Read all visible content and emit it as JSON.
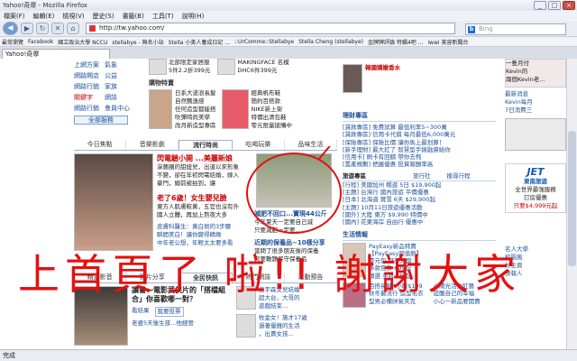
{
  "window": {
    "title": "Yahoo!奇摩 - Mozilla Firefox",
    "controls": [
      "_",
      "□",
      "×"
    ]
  },
  "menu": [
    "檔案(F)",
    "編輯(E)",
    "檢視(V)",
    "歷史(S)",
    "書籤(B)",
    "工具(T)",
    "說明(H)"
  ],
  "nav": {
    "url": "http://tw.yahoo.com/",
    "search_placeholder": "Bing",
    "search_engine_icon": "b"
  },
  "bookmarks": [
    "最常瀏覽",
    "Facebook",
    "國立政治大學 NCCU",
    "stellabye - 無名小站",
    "Stella 小美人養成日記 ...",
    "::UrComme::Stellabye",
    "Stella Cheng (stellabye)",
    "金牌牌評論 特輯4吧 ...",
    "iwwi 美容新聞台"
  ],
  "tab": {
    "label": "Yahoo!奇摩"
  },
  "page": {
    "left_services": {
      "rows": [
        [
          "上網方案",
          "氣象"
        ],
        [
          "網路開店",
          "公益"
        ],
        [
          "網路行銷",
          "家族"
        ],
        [
          "關鍵字",
          "網誌"
        ],
        [
          "網路行銷",
          "會員中心"
        ]
      ],
      "all_services": "全部服務"
    },
    "shopping": {
      "items": [
        "北部限定家居服",
        "5件2.2折399元"
      ],
      "items2": [
        "MAKINGFACE 名模",
        "DHC6件399元"
      ],
      "section_title": "購物特賣",
      "promo1": [
        "日系大波浪長髮",
        "自然飄逸感",
        "任何造型都能搭",
        "吹彈時尚美學",
        "改月新造型專區"
      ],
      "promo2": [
        "經典帆布鞋",
        "簡約百搭款",
        "NIKE新上架",
        "特價出清包鞋",
        "零元限量搶購中"
      ]
    },
    "tabs": [
      "今日焦點",
      "音樂影劇",
      "流行時尚",
      "吃喝玩樂",
      "品味生活"
    ],
    "active_tab_index": 2,
    "feature": {
      "headline": "閃電驗小開 ...美麗新娘",
      "body": [
        "演藝圈的甜妞兒，出道以來形象",
        "不變，卻在年初閃電結婚，嫁入",
        "豪門，婚前被拍到，讓"
      ],
      "headline2": "老了6歲！女生嬰兒臉",
      "body2": [
        "東方人肌膚較黃，五官也沒有外",
        "國人立體，再加上熬夜大多"
      ],
      "links": [
        "皮膚科醫生：黃白斑的3步驟",
        "瞬間美白！讓你變得精緻",
        "中年老公想，年輕太太要多看"
      ],
      "photo_caption": "減肥不回口...實現44公斤",
      "photo_body": [
        "今年夏天一定要自己減",
        "只要減肥一定要..."
      ],
      "news2": "近期的保養品~10樣分享",
      "news2_body": [
        "當問了很多朋友後的保養",
        "只要難題保守保養品"
      ]
    },
    "lower_tabs": [
      "精選影音",
      "影片分享",
      "全民快訊",
      "熱門網誌",
      "活動預告"
    ],
    "lower": {
      "headline": "讀書～電影武俠片的「搭檔組合」你喜歡哪一對？",
      "links": [
        "看結果",
        "我要投票"
      ],
      "link2": "老婆5天後生孩...他經營",
      "blog": [
        "吳宇森女兒結婚",
        "超大台，大哥的",
        "遊戲結束..."
      ],
      "blog2": [
        "牧金女！施才17歲",
        "過著優雅的生活",
        "，出賣女孩..."
      ]
    },
    "right": {
      "finance_title": "理財專區",
      "finance": [
        "[貸款專區] 免費試算 最低利率5~300萬",
        "[貸款專區] 信用卡代償 每月最低6,000萬元",
        "[保險專區] 保險比價 讓你馬上最划算！",
        "[新手理財] 最大紅了 智慧型手錶融資給你",
        "[信用卡] 刷卡有回饋 帶你去飛",
        "[置產規劃] 把握優惠 投資報酬率高"
      ],
      "travel_title": "旅遊專區",
      "travel_tabs": [
        "旅遊專區",
        "旅行社",
        "搜尋行程"
      ],
      "travel": [
        "[行程] 美國加州 暢遊 5日 $19,900起",
        "[主題] 台灣行 國內旅遊 平價優惠",
        "[日本] 北海道 賞雪 6天 $29,900起",
        "[主題] 10月11日旅遊優惠活動",
        "[國外] 大陸 東方 $9,990 特價中",
        "[國內] 花東海岸 自由行 優惠中"
      ],
      "life_title": "生活情報",
      "life": [
        "PayEasy新品特賣",
        "【PayEasy超值館】",
        "零元包 好評熱銷",
        "多款包款 699起",
        "精選 美妝 5折起"
      ],
      "bottom": [
        "百搭長靴4小時$199",
        "秋冬最流行 造型毛衣",
        "型男必備帥氣夾克"
      ],
      "bottom2": [
        "小陽光活力紅藝",
        "提醒自己的幸福",
        "小心一新品要開賣"
      ]
    },
    "far_right": {
      "top_ad": [
        "一隻月付",
        "Kevin的",
        "兩個Kevin老..."
      ],
      "mid": [
        "最新消息",
        "Kevin每月",
        "7日消費三"
      ],
      "ad_brand": "JET",
      "ad_sub": "東南旅遊",
      "ad_text": [
        "東南旅遊",
        "全世界最強服務",
        "訂房優惠",
        "只要$4,999元起"
      ],
      "life_items": [
        "名人大學",
        "校園風",
        "好主頁",
        "快報人"
      ]
    }
  },
  "overlay_text": "上首頁了 啦!! 謝謝大家",
  "status": "完成"
}
